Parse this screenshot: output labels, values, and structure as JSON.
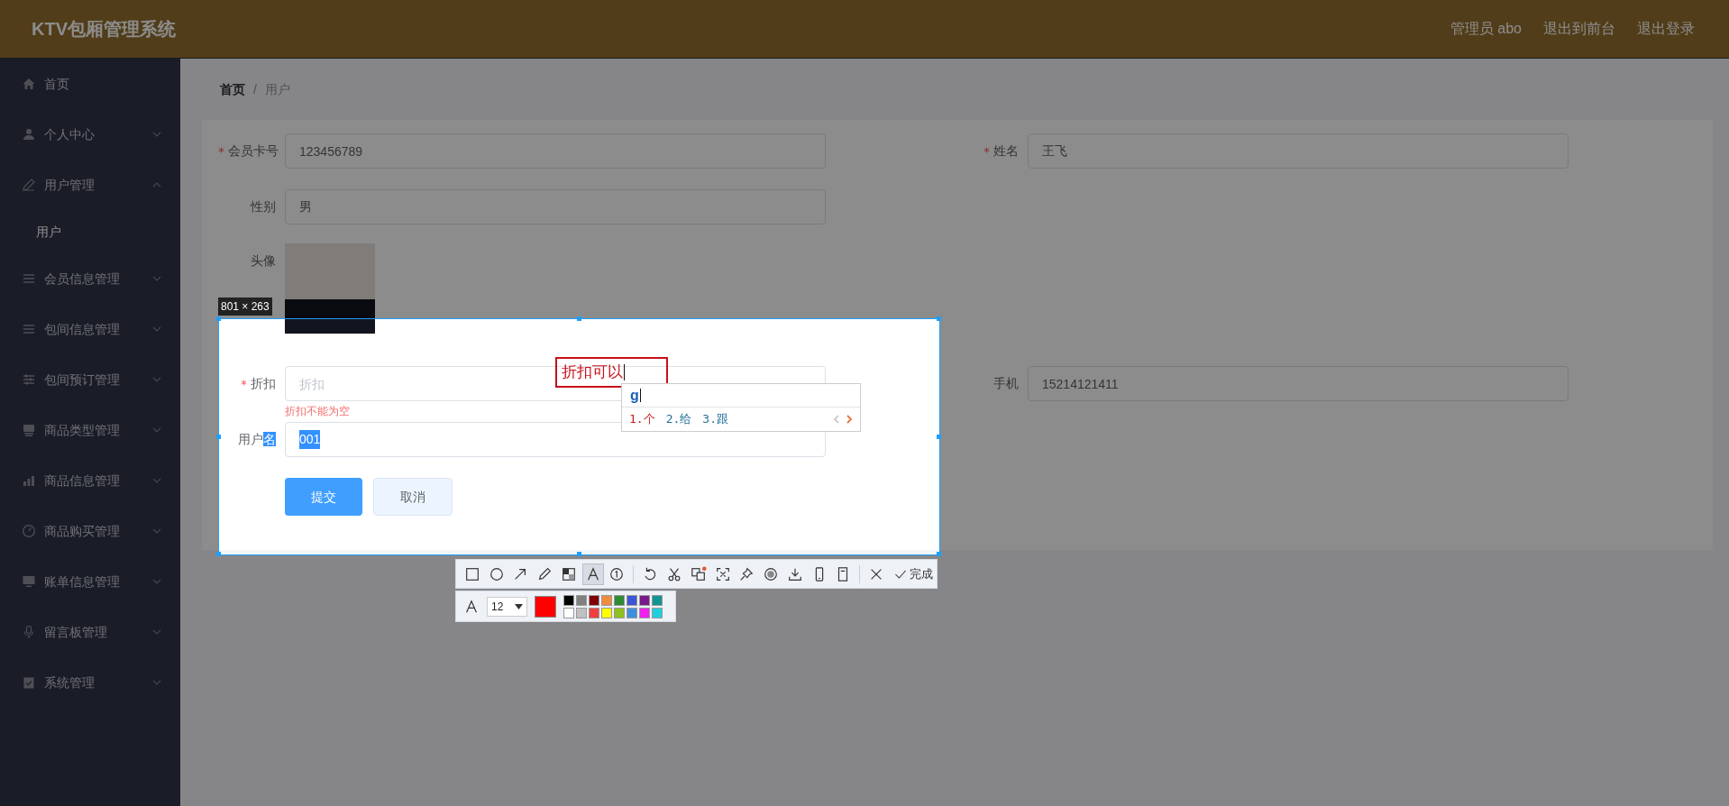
{
  "header": {
    "title": "KTV包厢管理系统",
    "links": [
      "管理员 abo",
      "退出到前台",
      "退出登录"
    ]
  },
  "sidebar": {
    "items": [
      {
        "label": "首页",
        "kind": "link",
        "selected": false
      },
      {
        "label": "个人中心",
        "kind": "submenu",
        "expanded": false,
        "selected": false
      },
      {
        "label": "用户管理",
        "kind": "submenu",
        "expanded": true,
        "selected": false,
        "children": [
          {
            "label": "用户",
            "selected": true
          }
        ]
      },
      {
        "label": "会员信息管理",
        "kind": "submenu",
        "expanded": false,
        "selected": false
      },
      {
        "label": "包间信息管理",
        "kind": "submenu",
        "expanded": false,
        "selected": false
      },
      {
        "label": "包间预订管理",
        "kind": "submenu",
        "expanded": false,
        "selected": false
      },
      {
        "label": "商品类型管理",
        "kind": "submenu",
        "expanded": false,
        "selected": false
      },
      {
        "label": "商品信息管理",
        "kind": "submenu",
        "expanded": false,
        "selected": false
      },
      {
        "label": "商品购买管理",
        "kind": "submenu",
        "expanded": false,
        "selected": false
      },
      {
        "label": "账单信息管理",
        "kind": "submenu",
        "expanded": false,
        "selected": false
      },
      {
        "label": "留言板管理",
        "kind": "submenu",
        "expanded": false,
        "selected": false
      },
      {
        "label": "系统管理",
        "kind": "submenu",
        "expanded": false,
        "selected": false
      }
    ]
  },
  "breadcrumb": {
    "items": [
      "首页",
      "用户"
    ],
    "separator": "/"
  },
  "form": {
    "rows": [
      [
        {
          "kind": "input",
          "label": "会员卡号",
          "required": true,
          "value": "123456789"
        },
        {
          "kind": "input",
          "label": "姓名",
          "required": true,
          "value": "王飞"
        }
      ],
      [
        {
          "kind": "input",
          "label": "性别",
          "required": false,
          "value": "男"
        }
      ],
      [
        {
          "kind": "image",
          "label": "头像",
          "required": false
        }
      ],
      [
        {
          "kind": "input",
          "label": "折扣",
          "required": true,
          "placeholder": "折扣",
          "error": "折扣不能为空"
        },
        {
          "kind": "input",
          "label": "手机",
          "required": false,
          "value": "15214121411"
        }
      ],
      [
        {
          "kind": "input",
          "label": "用户名",
          "required": false,
          "value": "001",
          "text_selected": true
        }
      ]
    ],
    "buttons": [
      {
        "label": "提交",
        "kind": "primary"
      },
      {
        "label": "取消",
        "kind": "secondary"
      }
    ]
  },
  "screenshot_tool": {
    "size_label": "801 × 263",
    "annotation": "折扣可以",
    "tools": [
      {
        "selected": false
      },
      {
        "selected": false
      },
      {
        "selected": false
      },
      {
        "selected": false
      },
      {
        "selected": false
      },
      {
        "selected": true
      },
      {
        "selected": false
      },
      {
        "selected": false
      },
      {
        "selected": false
      },
      {
        "selected": false
      },
      {
        "selected": false
      },
      {
        "selected": false
      },
      {
        "selected": false
      },
      {
        "selected": false
      },
      {
        "selected": false
      },
      {
        "selected": false
      }
    ],
    "done_label": "完成",
    "font_size": "12",
    "selected_color": {
      "color": "#ff0000"
    },
    "palette": [
      {
        "color": "#000000"
      },
      {
        "color": "#808080"
      },
      {
        "color": "#800000"
      },
      {
        "color": "#f08c40"
      },
      {
        "color": "#2f8a34"
      },
      {
        "color": "#3c56d6"
      },
      {
        "color": "#7a1a8a"
      },
      {
        "color": "#109494"
      },
      {
        "color": "#ffffff"
      },
      {
        "color": "#c0c0c0"
      },
      {
        "color": "#f04040"
      },
      {
        "color": "#ffff00"
      },
      {
        "color": "#90c020"
      },
      {
        "color": "#3f8fe0"
      },
      {
        "color": "#f020f0"
      },
      {
        "color": "#20d0e0"
      }
    ]
  },
  "ime": {
    "input": "g",
    "candidates": [
      {
        "text": "1.个",
        "selected": true
      },
      {
        "text": "2.给",
        "selected": false
      },
      {
        "text": "3.跟",
        "selected": false
      }
    ]
  }
}
